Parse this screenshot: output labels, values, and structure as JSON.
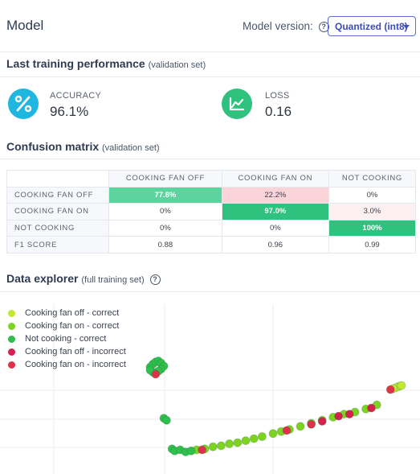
{
  "header": {
    "title": "Model",
    "model_version_label": "Model version:",
    "model_version_value": "Quantized (int8)"
  },
  "performance": {
    "title": "Last training performance",
    "subtitle": "(validation set)",
    "accuracy": {
      "label": "ACCURACY",
      "value": "96.1%",
      "icon": "percent-icon",
      "color": "#1fb6e0"
    },
    "loss": {
      "label": "LOSS",
      "value": "0.16",
      "icon": "chart-line-icon",
      "color": "#2ec27e"
    }
  },
  "confusion": {
    "title": "Confusion matrix",
    "subtitle": "(validation set)",
    "columns": [
      "COOKING FAN OFF",
      "COOKING FAN ON",
      "NOT COOKING"
    ],
    "rows": [
      {
        "label": "COOKING FAN OFF",
        "cells": [
          "77.8%",
          "22.2%",
          "0%"
        ]
      },
      {
        "label": "COOKING FAN ON",
        "cells": [
          "0%",
          "97.0%",
          "3.0%"
        ]
      },
      {
        "label": "NOT COOKING",
        "cells": [
          "0%",
          "0%",
          "100%"
        ]
      },
      {
        "label": "F1 SCORE",
        "cells": [
          "0.88",
          "0.96",
          "0.99"
        ]
      }
    ]
  },
  "explorer": {
    "title": "Data explorer",
    "subtitle": "(full training set)",
    "legend": [
      {
        "label": "Cooking fan off - correct",
        "color": "#c3e830"
      },
      {
        "label": "Cooking fan on - correct",
        "color": "#7ed321"
      },
      {
        "label": "Not cooking - correct",
        "color": "#2ebf4f"
      },
      {
        "label": "Cooking fan off - incorrect",
        "color": "#d6204f"
      },
      {
        "label": "Cooking fan on - incorrect",
        "color": "#e0304a"
      }
    ]
  },
  "chart_data": {
    "type": "scatter",
    "title": "",
    "xlabel": "",
    "ylabel": "",
    "grid": true,
    "legend_position": "top-left",
    "series": [
      {
        "name": "Cooking fan off - correct",
        "points": [
          [
            0.96,
            0.73
          ],
          [
            0.95,
            0.72
          ],
          [
            0.94,
            0.71
          ],
          [
            0.97,
            0.74
          ]
        ]
      },
      {
        "name": "Cooking fan on - correct",
        "points": [
          [
            0.22,
            0.11
          ],
          [
            0.25,
            0.12
          ],
          [
            0.28,
            0.14
          ],
          [
            0.31,
            0.15
          ],
          [
            0.34,
            0.17
          ],
          [
            0.37,
            0.18
          ],
          [
            0.4,
            0.2
          ],
          [
            0.43,
            0.22
          ],
          [
            0.46,
            0.24
          ],
          [
            0.5,
            0.27
          ],
          [
            0.53,
            0.29
          ],
          [
            0.56,
            0.31
          ],
          [
            0.6,
            0.34
          ],
          [
            0.64,
            0.37
          ],
          [
            0.68,
            0.4
          ],
          [
            0.72,
            0.43
          ],
          [
            0.76,
            0.46
          ],
          [
            0.8,
            0.48
          ],
          [
            0.84,
            0.51
          ],
          [
            0.88,
            0.55
          ]
        ]
      },
      {
        "name": "Not cooking - correct",
        "points": [
          [
            0.05,
            0.92
          ],
          [
            0.06,
            0.95
          ],
          [
            0.07,
            0.97
          ],
          [
            0.08,
            0.98
          ],
          [
            0.09,
            0.96
          ],
          [
            0.1,
            0.93
          ],
          [
            0.09,
            0.9
          ],
          [
            0.08,
            0.88
          ],
          [
            0.06,
            0.87
          ],
          [
            0.05,
            0.89
          ],
          [
            0.1,
            0.42
          ],
          [
            0.11,
            0.4
          ],
          [
            0.13,
            0.12
          ],
          [
            0.14,
            0.1
          ],
          [
            0.16,
            0.11
          ],
          [
            0.18,
            0.09
          ],
          [
            0.2,
            0.1
          ]
        ]
      },
      {
        "name": "Cooking fan off - incorrect",
        "points": [
          [
            0.68,
            0.39
          ],
          [
            0.74,
            0.44
          ],
          [
            0.78,
            0.46
          ],
          [
            0.86,
            0.52
          ]
        ]
      },
      {
        "name": "Cooking fan on - incorrect",
        "points": [
          [
            0.07,
            0.85
          ],
          [
            0.24,
            0.11
          ],
          [
            0.55,
            0.3
          ],
          [
            0.93,
            0.7
          ],
          [
            0.64,
            0.36
          ]
        ]
      }
    ]
  }
}
